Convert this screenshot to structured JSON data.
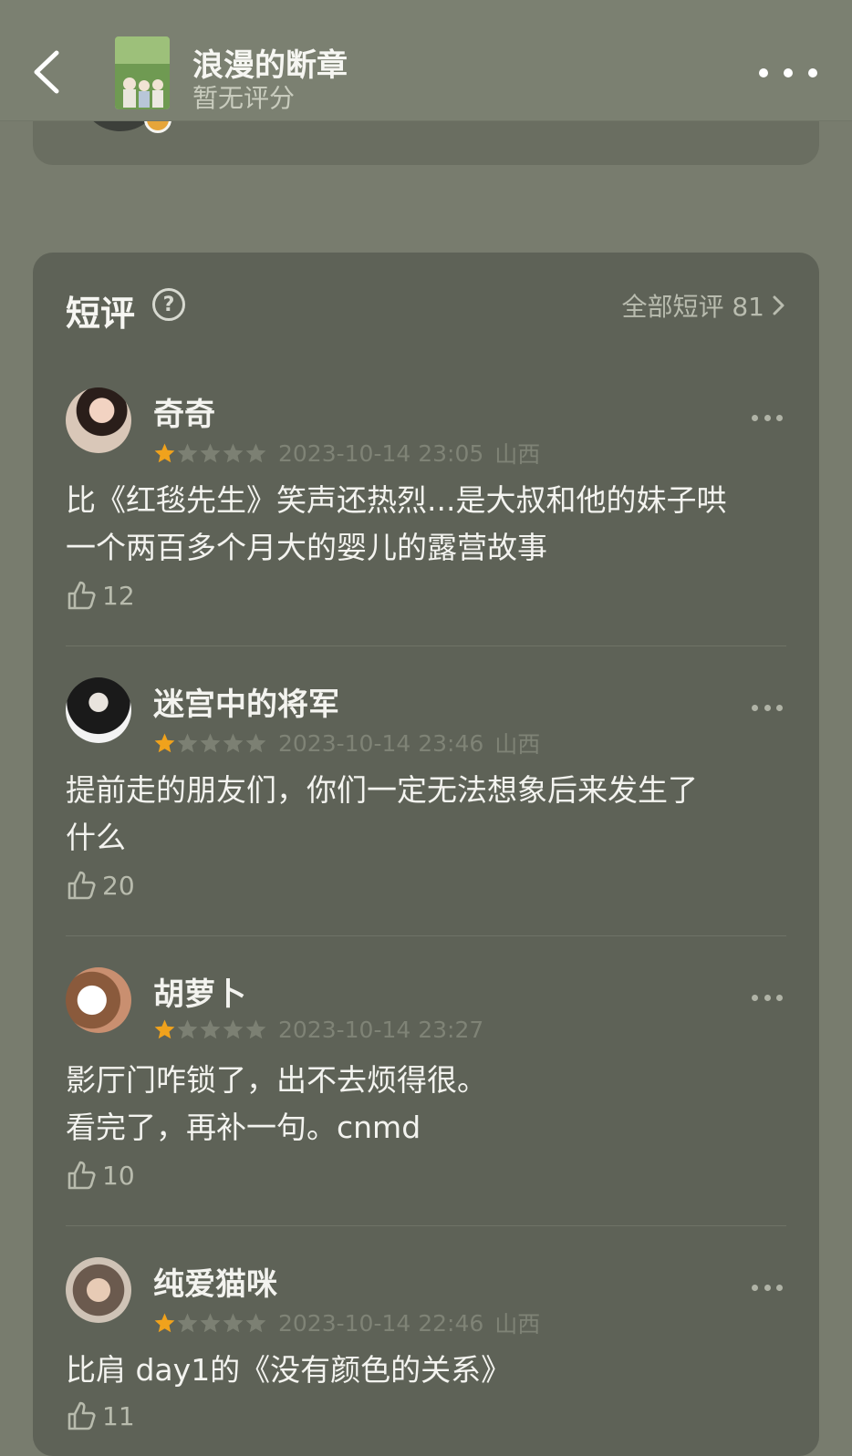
{
  "header": {
    "title": "浪漫的断章",
    "rating_text": "暂无评分"
  },
  "section": {
    "title": "短评",
    "all_link": "全部短评 81"
  },
  "reviews": [
    {
      "user": "奇奇",
      "rating": 1,
      "date": "2023-10-14 23:05",
      "location": "山西",
      "content": "比《红毯先生》笑声还热烈...是大叔和他的妹子哄\n一个两百多个月大的婴儿的露营故事",
      "likes": "12"
    },
    {
      "user": "迷宫中的将军",
      "rating": 1,
      "date": "2023-10-14 23:46",
      "location": "山西",
      "content": "提前走的朋友们，你们一定无法想象后来发生了\n什么",
      "likes": "20"
    },
    {
      "user": "胡萝卜",
      "rating": 1,
      "date": "2023-10-14 23:27",
      "location": "",
      "content": "影厅门咋锁了，出不去烦得很。\n看完了，再补一句。cnmd",
      "likes": "10"
    },
    {
      "user": "纯爱猫咪",
      "rating": 1,
      "date": "2023-10-14 22:46",
      "location": "山西",
      "content": "比肩 day1的《没有颜色的关系》",
      "likes": "11"
    }
  ],
  "colors": {
    "star_on": "#f0a21c",
    "star_off": "#7c8073",
    "background": "#787c6e",
    "panel": "#5e6257"
  },
  "icons": [
    "back-arrow-icon",
    "more-dots-icon",
    "help-icon",
    "chevron-right-icon",
    "star-icon",
    "thumbs-up-icon"
  ]
}
